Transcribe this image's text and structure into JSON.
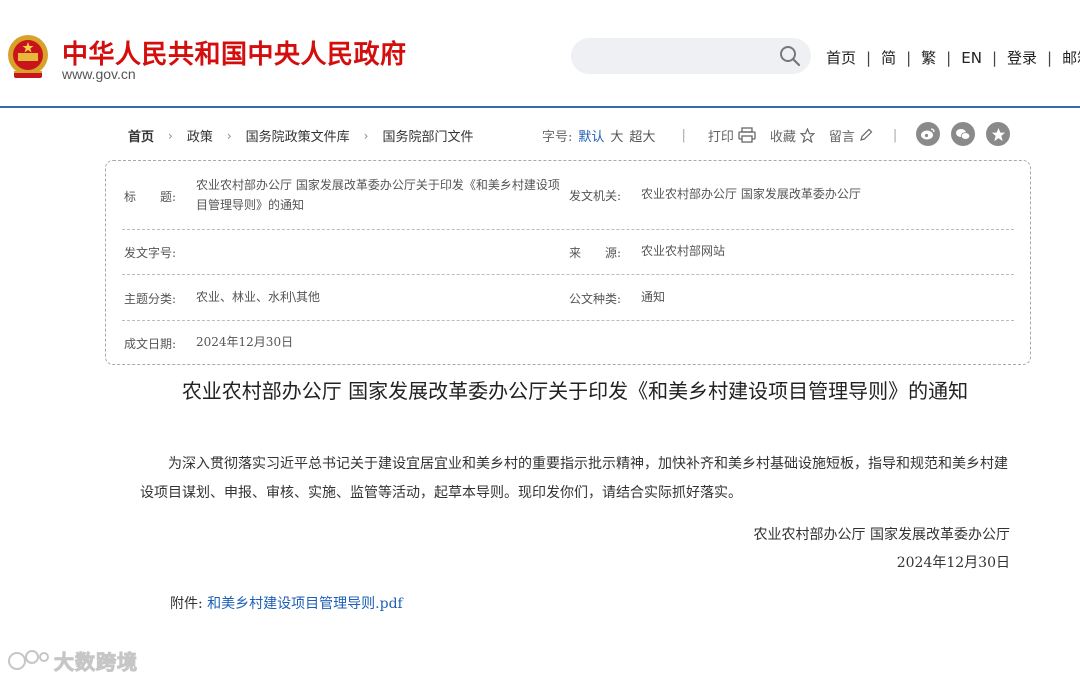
{
  "header": {
    "site_name": "中华人民共和国中央人民政府",
    "site_url": "www.gov.cn",
    "search_placeholder": "",
    "nav": [
      "首页",
      "简",
      "繁",
      "EN",
      "登录",
      "邮箱"
    ]
  },
  "breadcrumb": [
    "首页",
    "政策",
    "国务院政策文件库",
    "国务院部门文件"
  ],
  "tools": {
    "font_size_label": "字号:",
    "font_sizes": [
      "默认",
      "大",
      "超大"
    ],
    "print": "打印",
    "favorite": "收藏",
    "comment": "留言",
    "share_icons": [
      "weibo-icon",
      "wechat-icon",
      "favorite-star-icon"
    ]
  },
  "meta": {
    "title_label": "标　　题:",
    "title_value": "农业农村部办公厅 国家发展改革委办公厅关于印发《和美乡村建设项目管理导则》的通知",
    "issuer_label": "发文机关:",
    "issuer_value": "农业农村部办公厅 国家发展改革委办公厅",
    "doc_no_label": "发文字号:",
    "doc_no_value": "",
    "source_label": "来　　源:",
    "source_value": "农业农村部网站",
    "category_label": "主题分类:",
    "category_value": "农业、林业、水利\\其他",
    "doc_type_label": "公文种类:",
    "doc_type_value": "通知",
    "date_label": "成文日期:",
    "date_value": "2024年12月30日"
  },
  "article": {
    "title": "农业农村部办公厅 国家发展改革委办公厅关于印发《和美乡村建设项目管理导则》的通知",
    "body": "为深入贯彻落实习近平总书记关于建设宜居宜业和美乡村的重要指示批示精神，加快补齐和美乡村基础设施短板，指导和规范和美乡村建设项目谋划、申报、审核、实施、监管等活动，起草本导则。现印发你们，请结合实际抓好落实。",
    "signature": "农业农村部办公厅 国家发展改革委办公厅",
    "date": "2024年12月30日",
    "attachment_label": "附件:",
    "attachment_link": "和美乡村建设项目管理导则.pdf"
  },
  "watermark": "大数跨境",
  "colors": {
    "brand_red": "#d40d0d",
    "link_blue": "#1d5fb8",
    "header_rule": "#3a6aa8"
  }
}
